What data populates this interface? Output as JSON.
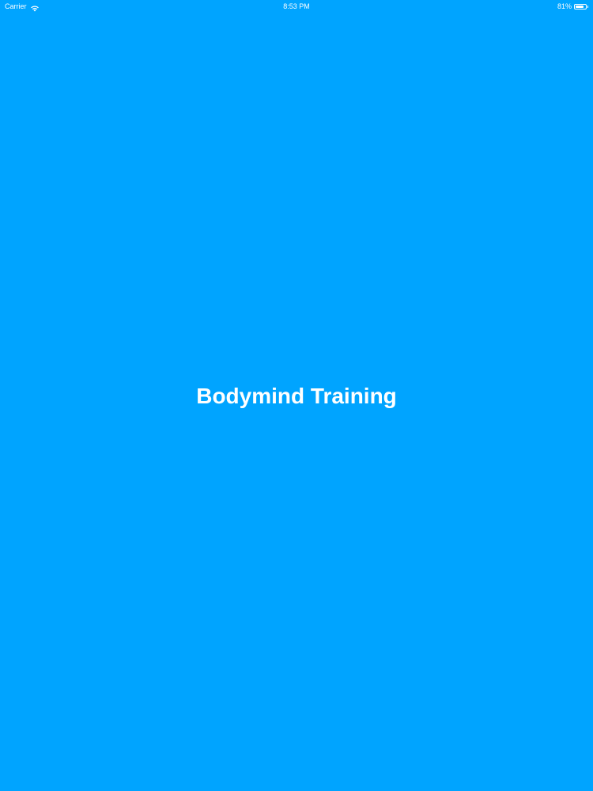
{
  "status_bar": {
    "carrier": "Carrier",
    "time": "8:53 PM",
    "battery_percent": "81%",
    "battery_level": 0.81,
    "icons": {
      "wifi": "wifi-icon",
      "battery": "battery-icon"
    }
  },
  "splash": {
    "title": "Bodymind Training"
  },
  "colors": {
    "background": "#00a4ff",
    "text": "#ffffff"
  }
}
